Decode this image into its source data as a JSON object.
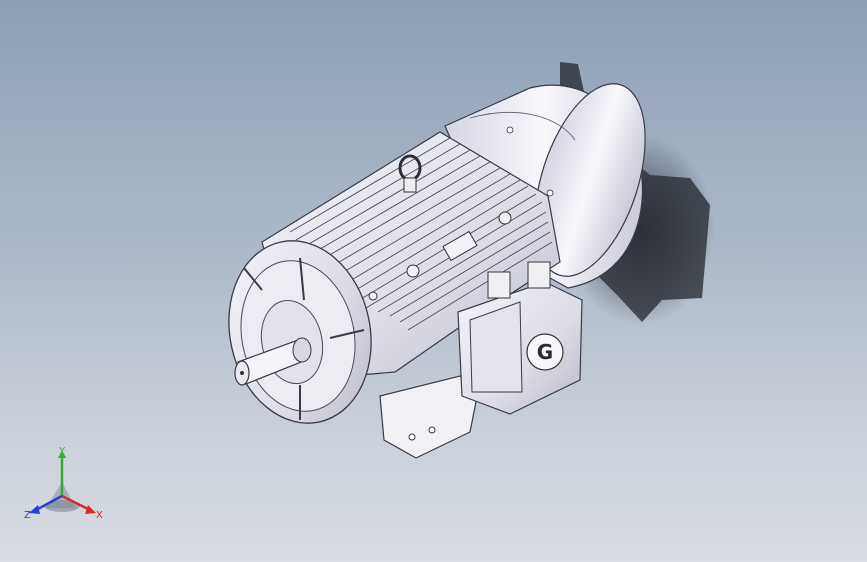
{
  "viewport": {
    "background_top": "#8e9fb4",
    "background_bottom": "#d9dde4",
    "model": "electric-motor-assembly",
    "terminal_box_logo": "G"
  },
  "triad": {
    "x_label": "X",
    "y_label": "Y",
    "z_label": "Z",
    "x_color": "#d42a2a",
    "y_color": "#2fb02f",
    "z_color": "#2a3fd4"
  }
}
